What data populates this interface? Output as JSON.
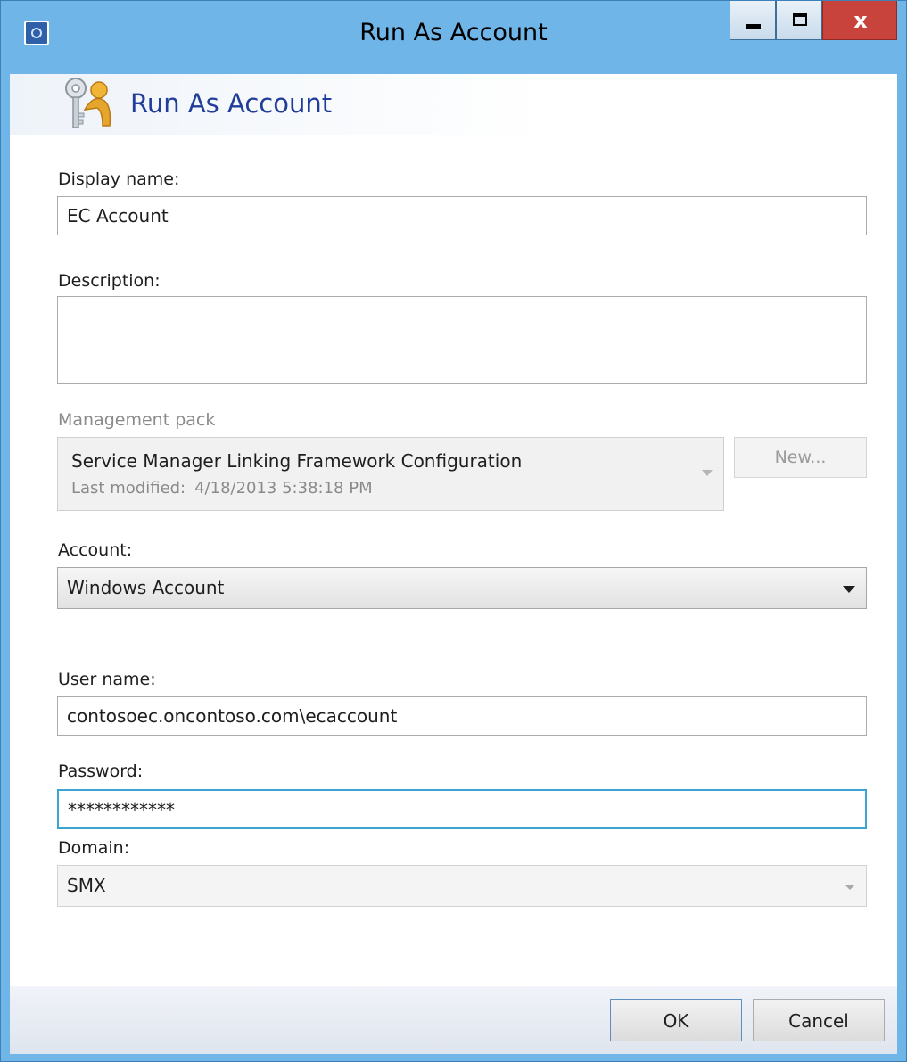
{
  "window": {
    "title": "Run As Account",
    "controls": {
      "minimize_icon": "minimize-icon",
      "maximize_icon": "maximize-icon",
      "close_label": "x"
    }
  },
  "header": {
    "title": "Run As Account",
    "icon": "key-person-icon"
  },
  "form": {
    "display_name": {
      "label": "Display name:",
      "value": "EC Account"
    },
    "description": {
      "label": "Description:",
      "value": ""
    },
    "management_pack": {
      "label": "Management pack",
      "name": "Service Manager Linking Framework Configuration",
      "last_modified_label": "Last modified:",
      "last_modified_value": "4/18/2013 5:38:18 PM",
      "new_button": "New..."
    },
    "account": {
      "label": "Account:",
      "value": "Windows Account"
    },
    "user_name": {
      "label": "User name:",
      "value": "contosoec.oncontoso.com\\ecaccount"
    },
    "password": {
      "label": "Password:",
      "value": "************"
    },
    "domain": {
      "label": "Domain:",
      "value": "SMX"
    }
  },
  "footer": {
    "ok_label": "OK",
    "cancel_label": "Cancel"
  },
  "colors": {
    "titlebar": "#6fb5e8",
    "header_title": "#1f3d99",
    "close_button": "#c8433b",
    "focus_border": "#3aa6cf"
  }
}
